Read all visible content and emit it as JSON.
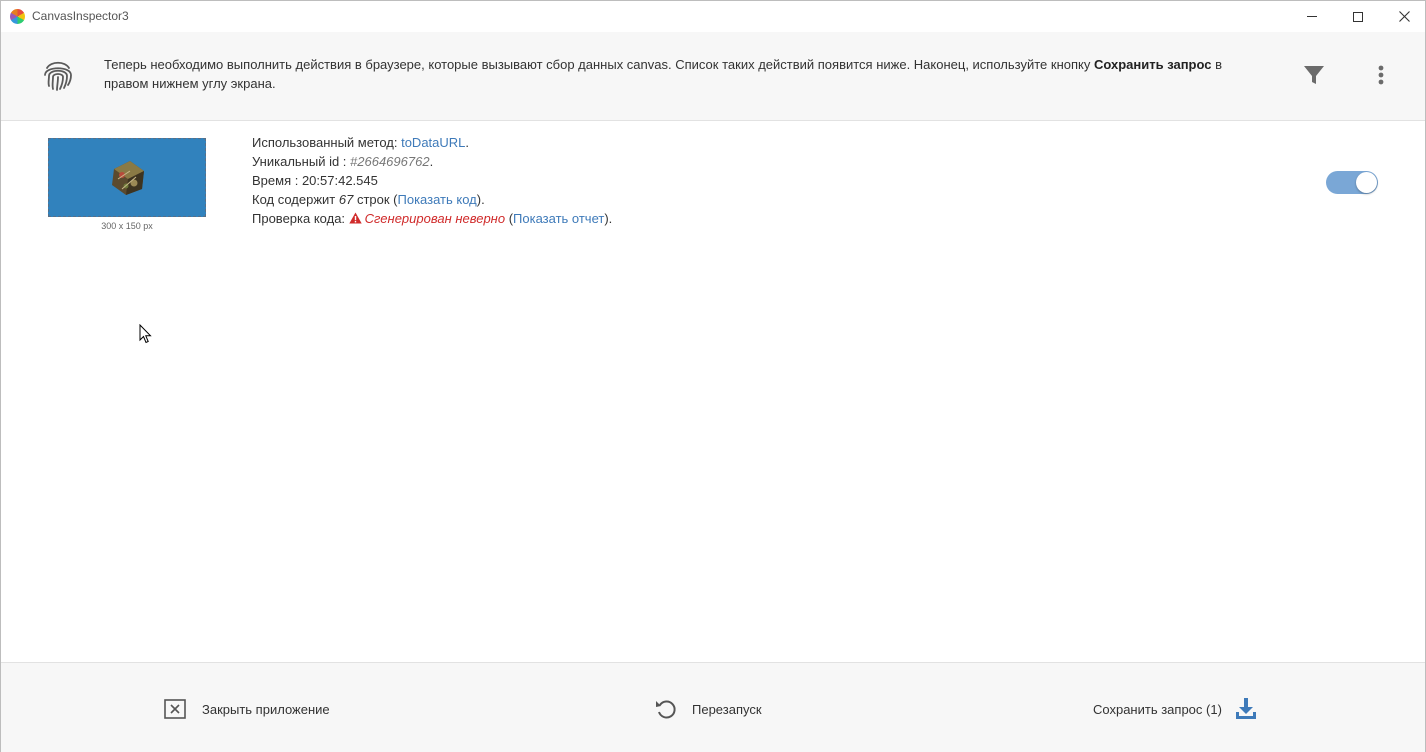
{
  "window": {
    "title": "CanvasInspector3"
  },
  "info": {
    "text_before": "Теперь необходимо выполнить действия в браузере, которые вызывают сбор данных canvas. Список таких действий появится ниже. Наконец, используйте кнопку ",
    "bold": "Сохранить запрос",
    "text_after": " в правом нижнем углу экрана."
  },
  "entry": {
    "thumb_caption": "300 x 150 px",
    "method_label": "Использованный метод: ",
    "method_value": "toDataURL",
    "id_label": "Уникальный id : ",
    "id_value": "#2664696762",
    "time_label": "Время : ",
    "time_value": "20:57:42.545",
    "code_label": "Код содержит ",
    "code_lines": "67",
    "code_suffix": " строк (",
    "code_link": "Показать код",
    "check_label": "Проверка кода: ",
    "check_status": "Сгенерирован неверно",
    "check_link": "Показать отчет",
    "toggle_on": true
  },
  "footer": {
    "close_label": "Закрыть приложение",
    "restart_label": "Перезапуск",
    "save_label": "Сохранить запрос (1)"
  },
  "colors": {
    "accent": "#3e7ab9",
    "error": "#d02b2b",
    "thumb_bg": "#3182bd",
    "toggle": "#7aa7d6"
  }
}
